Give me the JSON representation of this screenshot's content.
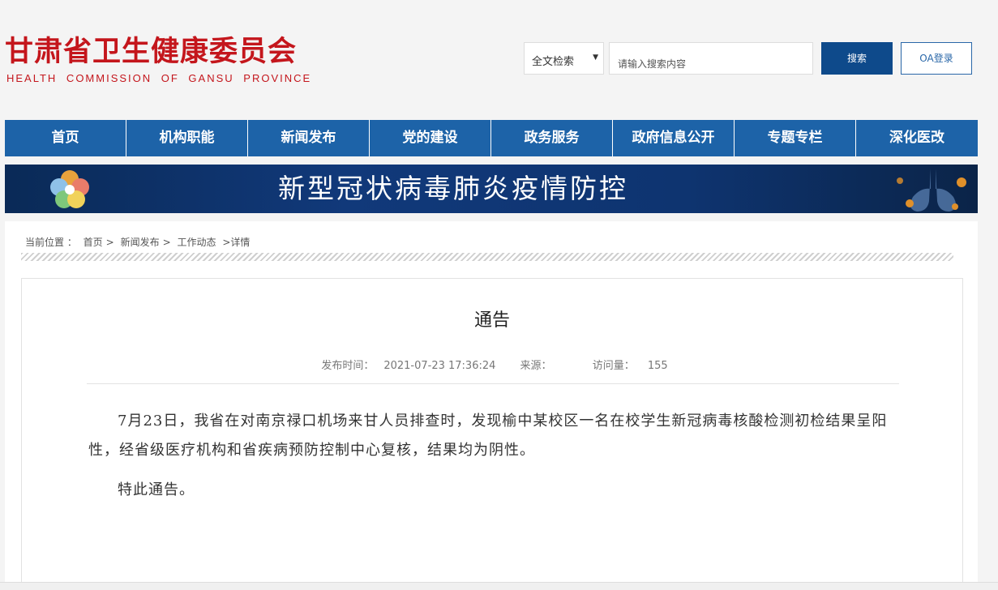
{
  "header": {
    "logo_cn": "甘肃省卫生健康委员会",
    "logo_en": "HEALTH COMMISSION OF GANSU PROVINCE"
  },
  "search": {
    "type_label": "全文检索",
    "placeholder": "请输入搜索内容",
    "button_label": "搜索",
    "oa_label": "OA登录"
  },
  "nav": {
    "items": [
      {
        "label": "首页"
      },
      {
        "label": "机构职能"
      },
      {
        "label": "新闻发布"
      },
      {
        "label": "党的建设"
      },
      {
        "label": "政务服务"
      },
      {
        "label": "政府信息公开"
      },
      {
        "label": "专题专栏"
      },
      {
        "label": "深化医改"
      }
    ]
  },
  "banner": {
    "title": "新型冠状病毒肺炎疫情防控"
  },
  "breadcrumb": {
    "prefix": "当前位置 ：",
    "home": "首页",
    "sep1": ">",
    "news": "新闻发布",
    "sep2": ">",
    "work": "工作动态",
    "detail": ">详情"
  },
  "article": {
    "title": "通告",
    "publish_label": "发布时间：",
    "publish_time": "2021-07-23 17:36:24",
    "source_label": "来源：",
    "visits_label": "访问量：",
    "visits": "155",
    "paragraphs": [
      "7月23日，我省在对南京禄口机场来甘人员排查时，发现榆中某校区一名在校学生新冠病毒核酸检测初检结果呈阳性，经省级医疗机构和省疾病预防控制中心复核，结果均为阴性。",
      "特此通告。"
    ]
  },
  "colors": {
    "brand_red": "#c4161c",
    "nav_blue": "#1d63a8",
    "search_blue": "#0e4a8b"
  }
}
